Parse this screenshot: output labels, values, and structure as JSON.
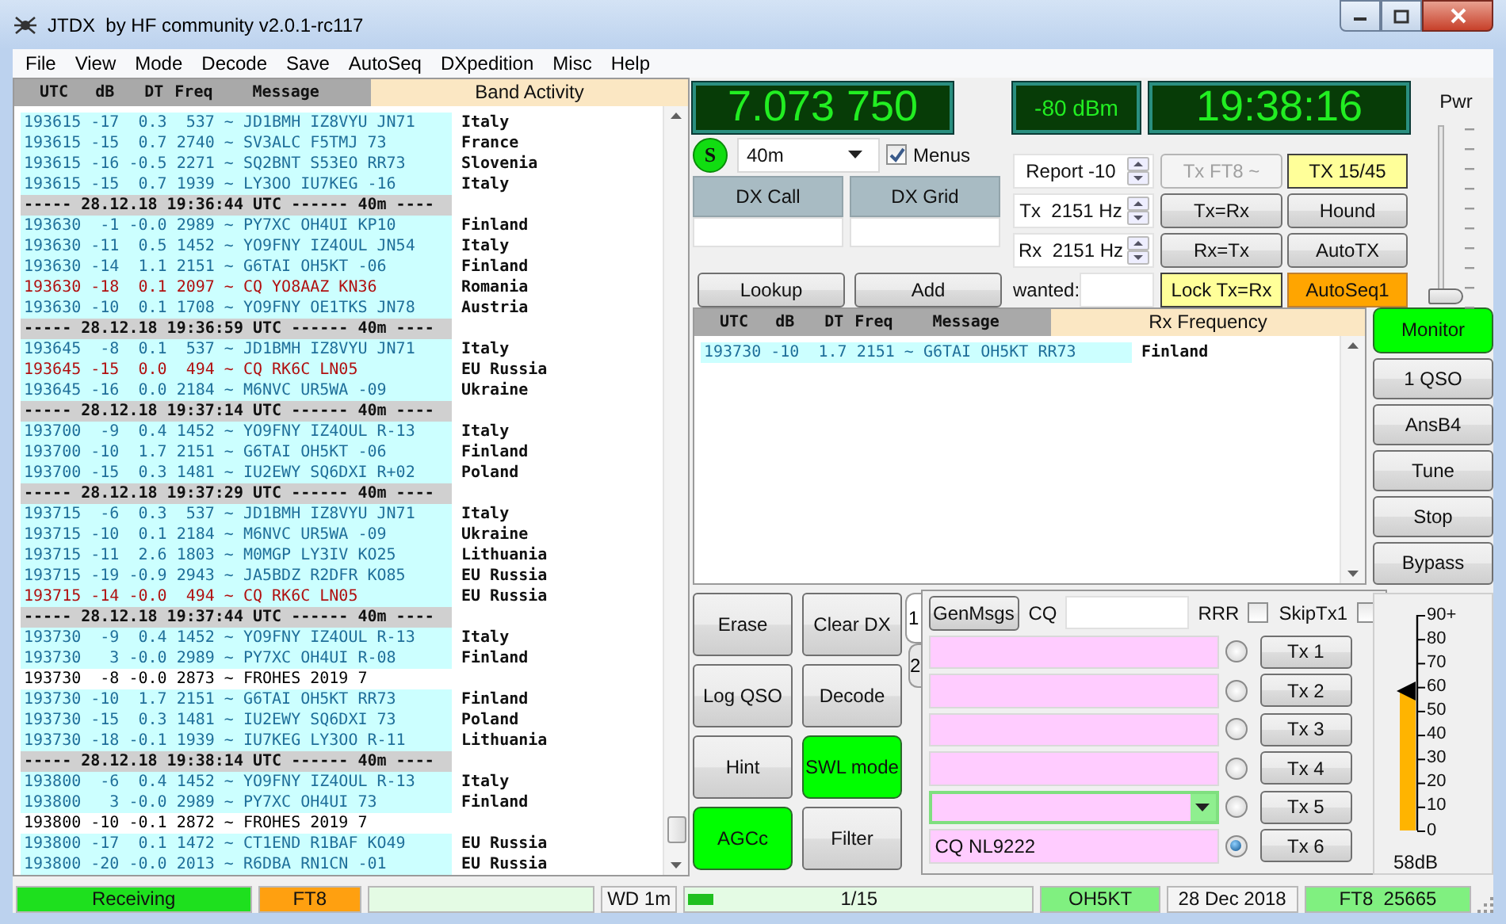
{
  "window": {
    "title": "JTDX  by HF community v2.0.1-rc117"
  },
  "menu": [
    "File",
    "View",
    "Mode",
    "Decode",
    "Save",
    "AutoSeq",
    "DXpedition",
    "Misc",
    "Help"
  ],
  "band_activity": {
    "columns": [
      "UTC",
      "dB",
      "DT",
      "Freq",
      "Message"
    ],
    "title": "Band Activity",
    "rows": [
      {
        "kind": "decode",
        "text": "193615 -17  0.3  537 ~ JD1BMH IZ8VYU JN71",
        "country": "Italy"
      },
      {
        "kind": "decode",
        "text": "193615 -15  0.7 2740 ~ SV3ALC F5TMJ 73",
        "country": "France"
      },
      {
        "kind": "decode",
        "text": "193615 -16 -0.5 2271 ~ SQ2BNT S53EO RR73",
        "country": "Slovenia"
      },
      {
        "kind": "decode",
        "text": "193615 -15  0.7 1939 ~ LY3OO IU7KEG -16",
        "country": "Italy"
      },
      {
        "kind": "separator",
        "text": "----- 28.12.18 19:36:44 UTC ------ 40m ----"
      },
      {
        "kind": "decode",
        "text": "193630  -1 -0.0 2989 ~ PY7XC OH4UI KP10",
        "country": "Finland"
      },
      {
        "kind": "decode",
        "text": "193630 -11  0.5 1452 ~ YO9FNY IZ4OUL JN54",
        "country": "Italy"
      },
      {
        "kind": "decode",
        "text": "193630 -14  1.1 2151 ~ G6TAI OH5KT -06",
        "country": "Finland"
      },
      {
        "kind": "cq",
        "text": "193630 -18  0.1 2097 ~ CQ YO8AAZ KN36",
        "country": "Romania"
      },
      {
        "kind": "decode",
        "text": "193630 -10  0.1 1708 ~ YO9FNY OE1TKS JN78",
        "country": "Austria"
      },
      {
        "kind": "separator",
        "text": "----- 28.12.18 19:36:59 UTC ------ 40m ----"
      },
      {
        "kind": "decode",
        "text": "193645  -8  0.1  537 ~ JD1BMH IZ8VYU JN71",
        "country": "Italy"
      },
      {
        "kind": "cq",
        "text": "193645 -15  0.0  494 ~ CQ RK6C LN05",
        "country": "EU Russia"
      },
      {
        "kind": "decode",
        "text": "193645 -16  0.0 2184 ~ M6NVC UR5WA -09",
        "country": "Ukraine"
      },
      {
        "kind": "separator",
        "text": "----- 28.12.18 19:37:14 UTC ------ 40m ----"
      },
      {
        "kind": "decode",
        "text": "193700  -9  0.4 1452 ~ YO9FNY IZ4OUL R-13",
        "country": "Italy"
      },
      {
        "kind": "decode",
        "text": "193700 -10  1.7 2151 ~ G6TAI OH5KT -06",
        "country": "Finland"
      },
      {
        "kind": "decode",
        "text": "193700 -15  0.3 1481 ~ IU2EWY SQ6DXI R+02",
        "country": "Poland"
      },
      {
        "kind": "separator",
        "text": "----- 28.12.18 19:37:29 UTC ------ 40m ----"
      },
      {
        "kind": "decode",
        "text": "193715  -6  0.3  537 ~ JD1BMH IZ8VYU JN71",
        "country": "Italy"
      },
      {
        "kind": "decode",
        "text": "193715 -10  0.1 2184 ~ M6NVC UR5WA -09",
        "country": "Ukraine"
      },
      {
        "kind": "decode",
        "text": "193715 -11  2.6 1803 ~ M0MGP LY3IV KO25",
        "country": "Lithuania"
      },
      {
        "kind": "decode",
        "text": "193715 -19 -0.9 2943 ~ JA5BDZ R2DFR KO85",
        "country": "EU Russia"
      },
      {
        "kind": "cq",
        "text": "193715 -14 -0.0  494 ~ CQ RK6C LN05",
        "country": "EU Russia"
      },
      {
        "kind": "separator",
        "text": "----- 28.12.18 19:37:44 UTC ------ 40m ----"
      },
      {
        "kind": "decode",
        "text": "193730  -9  0.4 1452 ~ YO9FNY IZ4OUL R-13",
        "country": "Italy"
      },
      {
        "kind": "decode",
        "text": "193730   3 -0.0 2989 ~ PY7XC OH4UI R-08",
        "country": "Finland"
      },
      {
        "kind": "plain",
        "text": "193730  -8 -0.0 2873 ~ FROHES 2019 7"
      },
      {
        "kind": "decode",
        "text": "193730 -10  1.7 2151 ~ G6TAI OH5KT RR73",
        "country": "Finland"
      },
      {
        "kind": "decode",
        "text": "193730 -15  0.3 1481 ~ IU2EWY SQ6DXI 73",
        "country": "Poland"
      },
      {
        "kind": "decode",
        "text": "193730 -18 -0.1 1939 ~ IU7KEG LY3OO R-11",
        "country": "Lithuania"
      },
      {
        "kind": "separator",
        "text": "----- 28.12.18 19:38:14 UTC ------ 40m ----"
      },
      {
        "kind": "decode",
        "text": "193800  -6  0.4 1452 ~ YO9FNY IZ4OUL R-13",
        "country": "Italy"
      },
      {
        "kind": "decode",
        "text": "193800   3 -0.0 2989 ~ PY7XC OH4UI 73",
        "country": "Finland"
      },
      {
        "kind": "plain",
        "text": "193800 -10 -0.1 2872 ~ FROHES 2019 7"
      },
      {
        "kind": "decode",
        "text": "193800 -17  0.1 1472 ~ CT1END R1BAF KO49",
        "country": "EU Russia"
      },
      {
        "kind": "decode",
        "text": "193800 -20 -0.0 2013 ~ R6DBA RN1CN -01",
        "country": "EU Russia"
      }
    ]
  },
  "frequency": "7.073 750",
  "signal_level": "-80 dBm",
  "clock": "19:38:16",
  "s_indicator": "S",
  "band": "40m",
  "menus_checkbox": {
    "label": "Menus",
    "checked": true
  },
  "dx_labels": [
    "DX Call",
    "DX Grid"
  ],
  "lookup_buttons": [
    "Lookup",
    "Add"
  ],
  "spinners": [
    "Report -10",
    "Tx  2151 Hz",
    "Rx  2151 Hz"
  ],
  "wanted_label": "wanted:",
  "control_buttons": [
    {
      "label": "Tx FT8 ~",
      "kind": "disabled"
    },
    {
      "label": "TX 15/45",
      "kind": "highlight"
    },
    {
      "label": "Tx=Rx",
      "kind": "plain"
    },
    {
      "label": "Hound",
      "kind": "plain"
    },
    {
      "label": "Rx=Tx",
      "kind": "plain"
    },
    {
      "label": "AutoTX",
      "kind": "plain"
    },
    {
      "label": "Lock Tx=Rx",
      "kind": "highlight"
    },
    {
      "label": "AutoSeq1",
      "kind": "alert"
    }
  ],
  "power": {
    "label": "Pwr",
    "level": 0
  },
  "rx_frequency": {
    "columns": [
      "UTC",
      "dB",
      "DT",
      "Freq",
      "Message"
    ],
    "title": "Rx Frequency",
    "rows": [
      {
        "kind": "decode",
        "text": "193730 -10  1.7 2151 ~ G6TAI OH5KT RR73",
        "country": "Finland"
      }
    ]
  },
  "left_buttons": [
    {
      "label": "Erase",
      "kind": "plain"
    },
    {
      "label": "Clear DX",
      "kind": "plain"
    },
    {
      "label": "Log QSO",
      "kind": "plain"
    },
    {
      "label": "Decode",
      "kind": "plain"
    },
    {
      "label": "Hint",
      "kind": "plain"
    },
    {
      "label": "SWL mode",
      "kind": "active"
    },
    {
      "label": "AGCc",
      "kind": "active"
    },
    {
      "label": "Filter",
      "kind": "plain"
    }
  ],
  "messages_tab": {
    "tabs": [
      {
        "label": "1",
        "selected": true
      },
      {
        "label": "2",
        "selected": false
      }
    ],
    "gen_button": "GenMsgs",
    "cq_label": "CQ",
    "rrr": {
      "label": "RRR",
      "checked": false
    },
    "skip_tx1": {
      "label": "SkipTx1",
      "checked": false
    },
    "tx_messages": [
      {
        "kind": "field",
        "selected": false,
        "button": "Tx 1"
      },
      {
        "kind": "field",
        "selected": false,
        "button": "Tx 2"
      },
      {
        "kind": "field",
        "selected": false,
        "button": "Tx 3"
      },
      {
        "kind": "field",
        "selected": false,
        "button": "Tx 4"
      },
      {
        "kind": "combo",
        "selected": false,
        "button": "Tx 5"
      },
      {
        "kind": "field",
        "value": "CQ NL9222",
        "selected": true,
        "button": "Tx 6"
      }
    ]
  },
  "side_buttons": [
    {
      "label": "Monitor",
      "kind": "active"
    },
    {
      "label": "1 QSO",
      "kind": "plain"
    },
    {
      "label": "AnsB4",
      "kind": "plain"
    },
    {
      "label": "Tune",
      "kind": "plain"
    },
    {
      "label": "Stop",
      "kind": "plain"
    },
    {
      "label": "Bypass",
      "kind": "plain"
    }
  ],
  "meter": {
    "scale": [
      "90+",
      "80",
      "70",
      "60",
      "50",
      "40",
      "30",
      "20",
      "10",
      "0"
    ],
    "level": 0.64,
    "reading": "58dB"
  },
  "status_bar": [
    {
      "kind": "text",
      "text": "Receiving",
      "color": "#1ee01e"
    },
    {
      "kind": "text",
      "text": "FT8",
      "color": "#ffa010"
    },
    {
      "kind": "blank",
      "color": "#e4fbe4"
    },
    {
      "kind": "text",
      "text": "WD 1m"
    },
    {
      "kind": "progress",
      "text": "1/15",
      "level": 0.07
    },
    {
      "kind": "text",
      "text": "OH5KT",
      "color": "#80f080"
    },
    {
      "kind": "text",
      "text": "28 Dec 2018"
    },
    {
      "kind": "text",
      "text": "FT8  25665",
      "color": "#80f080"
    }
  ]
}
